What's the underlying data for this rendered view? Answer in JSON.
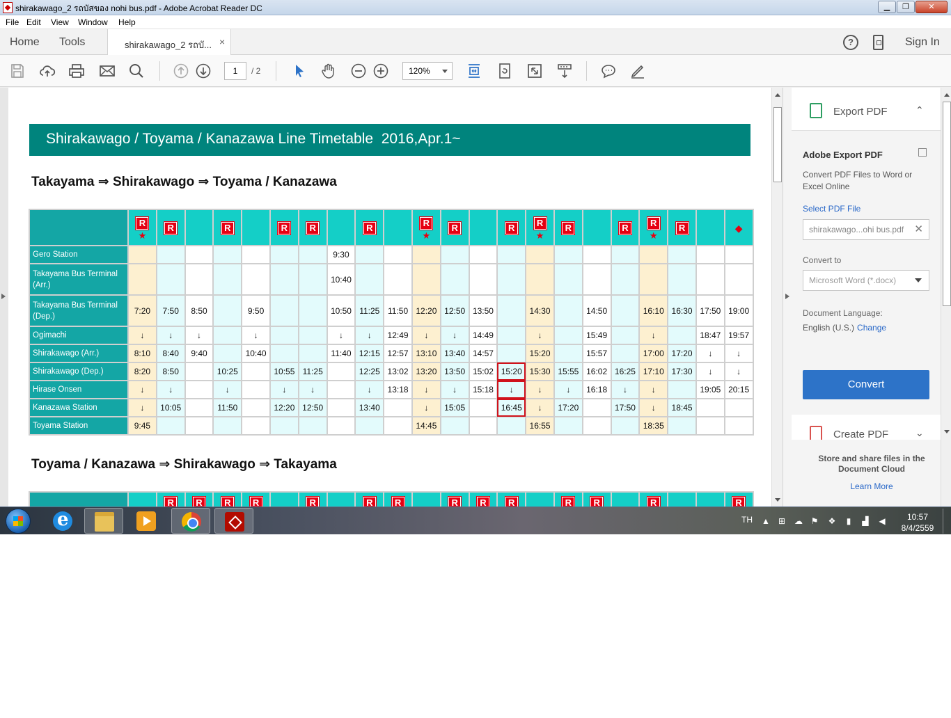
{
  "window": {
    "title": "shirakawago_2 รถบัสของ nohi bus.pdf - Adobe Acrobat Reader DC",
    "min_glyph": "▁",
    "max_glyph": "❐",
    "close_glyph": "✕"
  },
  "menu": [
    "File",
    "Edit",
    "View",
    "Window",
    "Help"
  ],
  "nav": {
    "home": "Home",
    "tools": "Tools",
    "doc_tab": "shirakawago_2 รถบั...",
    "doc_tab_close": "×",
    "help_glyph": "?",
    "sign_in": "Sign In"
  },
  "toolbar": {
    "page_current": "1",
    "page_total": "/ 2",
    "zoom": "120%"
  },
  "document": {
    "banner": "Shirakawago / Toyama / Kanazawa Line Timetable  2016,Apr.1~",
    "heading1": "Takayama ⇒ Shirakawago ⇒ Toyama / Kanazawa",
    "heading2": "Toyama / Kanazawa ⇒ Shirakawago ⇒ Takayama",
    "badge_letter": "R",
    "star_glyph": "★",
    "diamond_glyph": "◆",
    "columns": [
      {
        "badge": "R",
        "star": true,
        "tint": "y"
      },
      {
        "badge": "R",
        "star": false,
        "tint": "b"
      },
      {
        "badge": "",
        "star": false,
        "tint": "w"
      },
      {
        "badge": "R",
        "star": false,
        "tint": "b"
      },
      {
        "badge": "",
        "star": false,
        "tint": "w"
      },
      {
        "badge": "R",
        "star": false,
        "tint": "b"
      },
      {
        "badge": "R",
        "star": false,
        "tint": "b"
      },
      {
        "badge": "",
        "star": false,
        "tint": "w"
      },
      {
        "badge": "R",
        "star": false,
        "tint": "b"
      },
      {
        "badge": "",
        "star": false,
        "tint": "w"
      },
      {
        "badge": "R",
        "star": true,
        "tint": "y"
      },
      {
        "badge": "R",
        "star": false,
        "tint": "b"
      },
      {
        "badge": "",
        "star": false,
        "tint": "w"
      },
      {
        "badge": "R",
        "star": false,
        "tint": "b"
      },
      {
        "badge": "R",
        "star": true,
        "tint": "y"
      },
      {
        "badge": "R",
        "star": false,
        "tint": "b"
      },
      {
        "badge": "",
        "star": false,
        "tint": "w"
      },
      {
        "badge": "R",
        "star": false,
        "tint": "b"
      },
      {
        "badge": "R",
        "star": true,
        "tint": "y"
      },
      {
        "badge": "R",
        "star": false,
        "tint": "b"
      },
      {
        "badge": "",
        "star": false,
        "tint": "w"
      },
      {
        "badge": "diamond",
        "star": false,
        "tint": "w"
      }
    ],
    "rows": [
      {
        "station": "Gero Station",
        "tall": false,
        "times": [
          "",
          "",
          "",
          "",
          "",
          "",
          "",
          "9:30",
          "",
          "",
          "",
          "",
          "",
          "",
          "",
          "",
          "",
          "",
          "",
          "",
          "",
          ""
        ]
      },
      {
        "station": "Takayama Bus Terminal (Arr.)",
        "tall": true,
        "times": [
          "",
          "",
          "",
          "",
          "",
          "",
          "",
          "10:40",
          "",
          "",
          "",
          "",
          "",
          "",
          "",
          "",
          "",
          "",
          "",
          "",
          "",
          ""
        ]
      },
      {
        "station": "Takayama Bus Terminal (Dep.)",
        "tall": true,
        "times": [
          "7:20",
          "7:50",
          "8:50",
          "",
          "9:50",
          "",
          "",
          "10:50",
          "11:25",
          "11:50",
          "12:20",
          "12:50",
          "13:50",
          "",
          "14:30",
          "",
          "14:50",
          "",
          "16:10",
          "16:30",
          "17:50",
          "19:00"
        ]
      },
      {
        "station": "Ogimachi",
        "tall": false,
        "times": [
          "↓",
          "↓",
          "↓",
          "",
          "↓",
          "",
          "",
          "↓",
          "↓",
          "12:49",
          "↓",
          "↓",
          "14:49",
          "",
          "↓",
          "",
          "15:49",
          "",
          "↓",
          "",
          "18:47",
          "19:57"
        ]
      },
      {
        "station": "Shirakawago (Arr.)",
        "tall": false,
        "times": [
          "8:10",
          "8:40",
          "9:40",
          "",
          "10:40",
          "",
          "",
          "11:40",
          "12:15",
          "12:57",
          "13:10",
          "13:40",
          "14:57",
          "",
          "15:20",
          "",
          "15:57",
          "",
          "17:00",
          "17:20",
          "↓",
          "↓"
        ]
      },
      {
        "station": "Shirakawago (Dep.)",
        "tall": false,
        "times": [
          "8:20",
          "8:50",
          "",
          "10:25",
          "",
          "10:55",
          "11:25",
          "",
          "12:25",
          "13:02",
          "13:20",
          "13:50",
          "15:02",
          "15:20",
          "15:30",
          "15:55",
          "16:02",
          "16:25",
          "17:10",
          "17:30",
          "↓",
          "↓"
        ]
      },
      {
        "station": "Hirase Onsen",
        "tall": false,
        "times": [
          "↓",
          "↓",
          "",
          "↓",
          "",
          "↓",
          "↓",
          "",
          "↓",
          "13:18",
          "↓",
          "↓",
          "15:18",
          "↓",
          "↓",
          "↓",
          "16:18",
          "↓",
          "↓",
          "",
          "19:05",
          "20:15"
        ]
      },
      {
        "station": "Kanazawa Station",
        "tall": false,
        "times": [
          "↓",
          "10:05",
          "",
          "11:50",
          "",
          "12:20",
          "12:50",
          "",
          "13:40",
          "",
          "↓",
          "15:05",
          "",
          "16:45",
          "↓",
          "17:20",
          "",
          "17:50",
          "↓",
          "18:45",
          "",
          ""
        ]
      },
      {
        "station": "Toyama Station",
        "tall": false,
        "times": [
          "9:45",
          "",
          "",
          "",
          "",
          "",
          "",
          "",
          "",
          "",
          "14:45",
          "",
          "",
          "",
          "16:55",
          "",
          "",
          "",
          "18:35",
          "",
          "",
          ""
        ]
      }
    ],
    "second_table_badges": [
      "",
      "R",
      "R",
      "R",
      "R",
      "",
      "R",
      "",
      "R",
      "R",
      "",
      "R",
      "R",
      "R",
      "",
      "R",
      "R",
      "",
      "R",
      "",
      "",
      "R"
    ]
  },
  "right_pane": {
    "export_header": "Export PDF",
    "title": "Adobe Export PDF",
    "description": "Convert PDF Files to Word or Excel Online",
    "select_link": "Select PDF File",
    "filename": "shirakawago...ohi bus.pdf",
    "clear_glyph": "✕",
    "convert_to_label": "Convert to",
    "convert_to_value": "Microsoft Word (*.docx)",
    "doc_language_label": "Document Language:",
    "doc_language_value": "English (U.S.)",
    "change_link": "Change",
    "convert_button": "Convert",
    "create_header": "Create PDF",
    "expand_glyph": "⌃",
    "collapse_glyph": "⌄",
    "cloud_text": "Store and share files in the Document Cloud",
    "learn_more": "Learn More"
  },
  "taskbar": {
    "lang": "TH",
    "time": "10:57",
    "date": "8/4/2559"
  }
}
